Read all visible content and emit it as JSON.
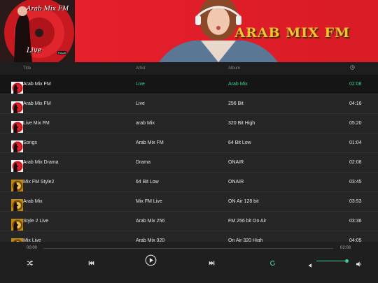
{
  "header": {
    "cover_title": "Arab Mix FM",
    "cover_subtitle": "Live",
    "cover_badge": "RAUB",
    "banner_title": "ARAB MIX FM"
  },
  "columns": {
    "title": "Title",
    "artist": "Artist",
    "album": "Album",
    "duration_icon": "clock-icon"
  },
  "tracks": [
    {
      "title": "Arab Mix FM",
      "artist": "Live",
      "album": "Arab Mix",
      "duration": "02:08",
      "thumb": "red-disc"
    },
    {
      "title": "Arab Mix FM",
      "artist": "Live",
      "album": "256 Bit",
      "duration": "04:16",
      "thumb": "red-disc"
    },
    {
      "title": "Live Mix FM",
      "artist": "arab Mix",
      "album": "320 Bit High",
      "duration": "05:20",
      "thumb": "red-disc"
    },
    {
      "title": "Songs",
      "artist": "Arab Mix FM",
      "album": "64 Bit Low",
      "duration": "01:04",
      "thumb": "red-disc"
    },
    {
      "title": "Arab Mix Drama",
      "artist": "Drama",
      "album": "ONAIR",
      "duration": "02:08",
      "thumb": "red-disc"
    },
    {
      "title": "Mix FM Style2",
      "artist": "64 Bit Low",
      "album": "ONAIR",
      "duration": "03:45",
      "thumb": "gold-disc"
    },
    {
      "title": "Arab Mix",
      "artist": "Mix FM Live",
      "album": "ON Air 128 bit",
      "duration": "03:53",
      "thumb": "gold-disc"
    },
    {
      "title": "Style 2 Live",
      "artist": "Arab Mix 256",
      "album": "FM 256 bit On Air",
      "duration": "03:36",
      "thumb": "gold-disc"
    },
    {
      "title": "Mix Live",
      "artist": "Arab Mix 320",
      "album": "On Air 320 High",
      "duration": "04:05",
      "thumb": "gold-disc"
    }
  ],
  "player": {
    "current_time": "00:00",
    "total_time": "02:08",
    "progress": 0,
    "volume": 0.95
  },
  "colors": {
    "accent": "#3fd08f",
    "header_red": "#e01e2a",
    "background": "#262626"
  }
}
